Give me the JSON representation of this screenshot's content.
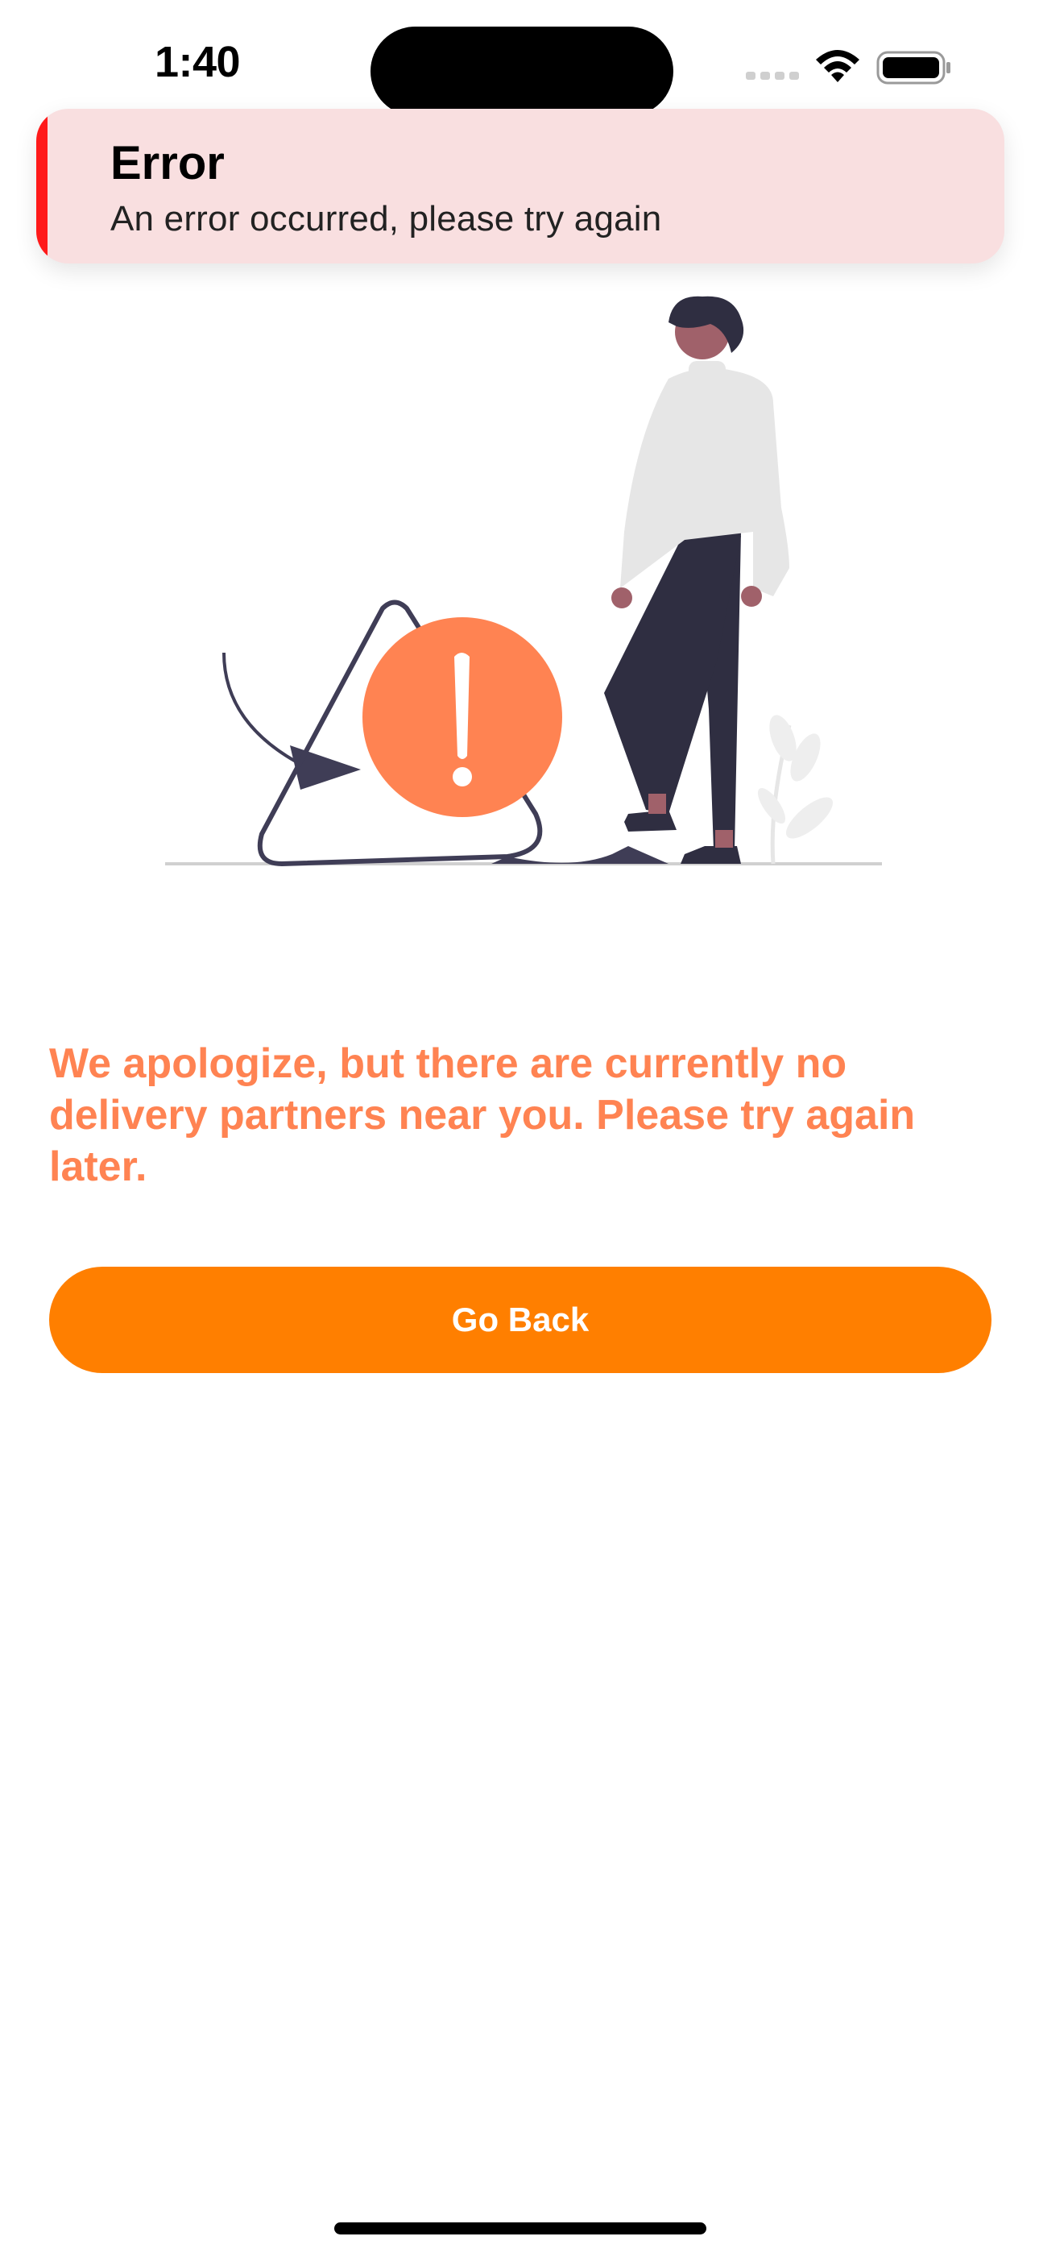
{
  "status_bar": {
    "time": "1:40",
    "wifi_icon": "wifi-icon",
    "battery_icon": "battery-icon",
    "signal_icon": "cellular-signal-icon"
  },
  "toast": {
    "title": "Error",
    "message": "An error occurred, please try again",
    "accent_color": "#ff1a1a",
    "background_color": "#f9dfe0"
  },
  "illustration": {
    "icon": "warning-illustration",
    "accent_color": "#ff8352"
  },
  "main": {
    "message": "We apologize, but there are currently no delivery partners near you. Please try again later.",
    "message_color": "#ff8352",
    "button_label": "Go Back",
    "button_color": "#ff7f00"
  }
}
